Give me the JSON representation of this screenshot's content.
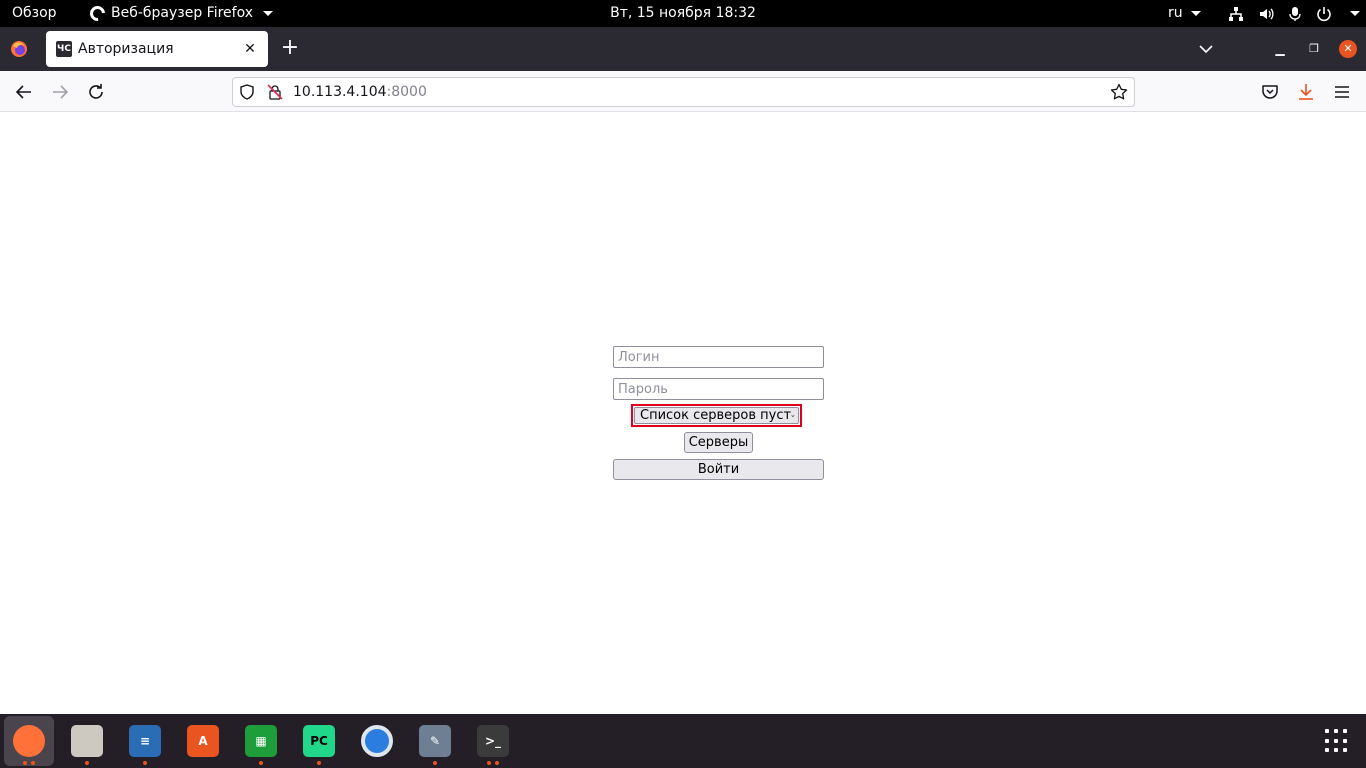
{
  "topbar": {
    "activities": "Обзор",
    "app_menu": "Веб-браузер Firefox",
    "clock": "Вт, 15 ноября  18:32",
    "language": "ru"
  },
  "tabs": [
    {
      "favicon_text": "ЧС",
      "title": "Авторизация",
      "active": true
    }
  ],
  "urlbar": {
    "host": "10.113.4.104",
    "port": ":8000"
  },
  "form": {
    "login_placeholder": "Логин",
    "login_value": "",
    "password_placeholder": "Пароль",
    "password_value": "",
    "server_select_value": "Список серверов пуст",
    "servers_button": "Серверы",
    "submit_button": "Войти"
  },
  "dock": {
    "items": [
      {
        "name": "firefox",
        "color": "#ff7139",
        "active": true,
        "dots": 2
      },
      {
        "name": "files",
        "color": "#cdc8c0",
        "active": false,
        "dots": 1
      },
      {
        "name": "libreoffice-writer",
        "color": "#2a6db5",
        "active": false,
        "dots": 1
      },
      {
        "name": "ubuntu-software",
        "color": "#e95420",
        "active": false,
        "dots": 0
      },
      {
        "name": "libreoffice-calc",
        "color": "#1e9e3a",
        "active": false,
        "dots": 1
      },
      {
        "name": "pycharm",
        "color": "#21d789",
        "active": false,
        "dots": 1
      },
      {
        "name": "chromium",
        "color": "#3a8ee6",
        "active": false,
        "dots": 0
      },
      {
        "name": "paint-brush",
        "color": "#6e7f94",
        "active": false,
        "dots": 1
      },
      {
        "name": "terminal",
        "color": "#3b3b3b",
        "active": false,
        "dots": 2
      }
    ]
  },
  "colors": {
    "accent": "#e95420",
    "highlight_border": "#e0001b"
  }
}
